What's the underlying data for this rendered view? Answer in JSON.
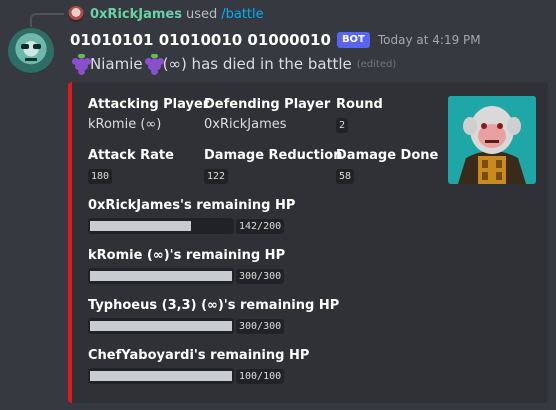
{
  "reply": {
    "user": "0xRickJames",
    "used": "used",
    "command": "/battle"
  },
  "message": {
    "username": "01010101 01010010 01000010",
    "bot_tag": "BOT",
    "timestamp": "Today at 4:19 PM",
    "text_name": "Niamie",
    "text_rest": " (∞) has died in the battle",
    "edited": "(edited)"
  },
  "embed": {
    "accent_color": "#e01b1b",
    "fields": {
      "attacking_player": {
        "name": "Attacking Player",
        "value": "kRomie (∞)"
      },
      "defending_player": {
        "name": "Defending Player",
        "value": "0xRickJames"
      },
      "round": {
        "name": "Round",
        "value": "2"
      },
      "attack_rate": {
        "name": "Attack Rate",
        "value": "180"
      },
      "damage_reduction": {
        "name": "Damage Reduction",
        "value": "122"
      },
      "damage_done": {
        "name": "Damage Done",
        "value": "58"
      }
    },
    "hp": [
      {
        "name": "0xRickJames's remaining HP",
        "value": "142/200",
        "fraction": 0.71
      },
      {
        "name": "kRomie (∞)'s remaining HP",
        "value": "300/300",
        "fraction": 1.0
      },
      {
        "name": "Typhoeus (3,3) (∞)'s remaining HP",
        "value": "300/300",
        "fraction": 1.0
      },
      {
        "name": "ChefYaboyardi's remaining HP",
        "value": "100/100",
        "fraction": 1.0
      }
    ]
  }
}
